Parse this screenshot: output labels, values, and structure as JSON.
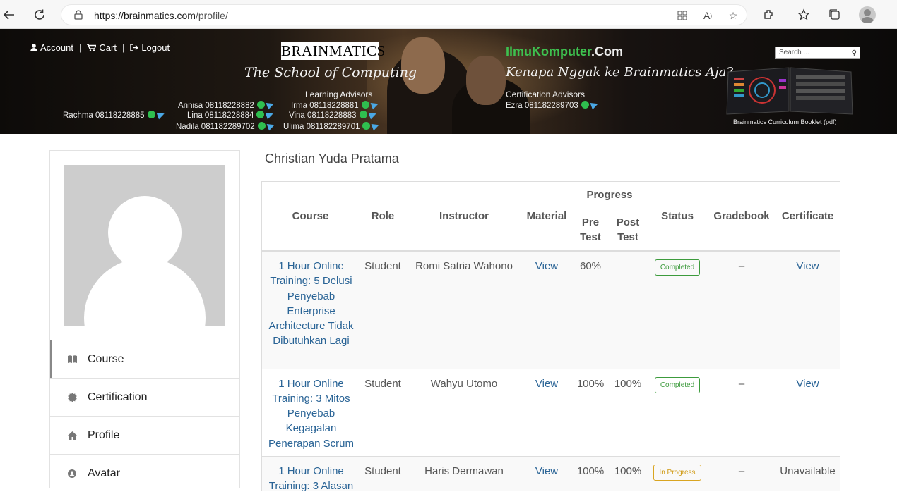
{
  "browser": {
    "url_host": "https://brainmatics.com",
    "url_path": "/profile/"
  },
  "banner": {
    "nav": {
      "account": "Account",
      "cart": "Cart",
      "logout": "Logout"
    },
    "brand": "BRAINMATICS",
    "brand_tagline": "The School of Computing",
    "learning_advisors_title": "Learning Advisors",
    "learning_contacts": [
      "Rachma 08118228885",
      "Annisa 08118228882",
      "Irma 08118228881",
      "Lina 08118228884",
      "Vina 08118228883",
      "Nadila 081182289702",
      "Ulima 081182289701"
    ],
    "ilmu_brand": "IlmuKomputer",
    "ilmu_com": ".Com",
    "ilmu_tagline": "Kenapa Nggak ke Brainmatics Aja?",
    "cert_advisors_title": "Certification Advisors",
    "cert_contact": "Ezra 081182289703",
    "search_placeholder": "Search ...",
    "booklet_caption": "Brainmatics Curriculum Booklet (pdf)"
  },
  "sidebar": {
    "menu": [
      {
        "label": "Course",
        "icon": "book-icon"
      },
      {
        "label": "Certification",
        "icon": "certificate-icon"
      },
      {
        "label": "Profile",
        "icon": "home-icon"
      },
      {
        "label": "Avatar",
        "icon": "user-circle-icon"
      }
    ]
  },
  "main": {
    "user_name": "Christian Yuda Pratama",
    "table": {
      "headers": {
        "course": "Course",
        "role": "Role",
        "instructor": "Instructor",
        "material": "Material",
        "progress": "Progress",
        "pre_test": "Pre Test",
        "post_test": "Post Test",
        "status": "Status",
        "gradebook": "Gradebook",
        "certificate": "Certificate"
      },
      "rows": [
        {
          "course": "1 Hour Online Training: 5 Delusi Penyebab Enterprise Architecture Tidak Dibutuhkan Lagi",
          "role": "Student",
          "instructor": "Romi Satria Wahono",
          "material": "View",
          "pre_test": "60%",
          "post_test": "",
          "status": "Completed",
          "gradebook": "–",
          "certificate": "View"
        },
        {
          "course": "1 Hour Online Training: 3 Mitos Penyebab Kegagalan Penerapan Scrum",
          "role": "Student",
          "instructor": "Wahyu Utomo",
          "material": "View",
          "pre_test": "100%",
          "post_test": "100%",
          "status": "Completed",
          "gradebook": "–",
          "certificate": "View"
        },
        {
          "course": "1 Hour Online Training: 3 Alasan",
          "role": "Student",
          "instructor": "Haris Dermawan",
          "material": "View",
          "pre_test": "100%",
          "post_test": "100%",
          "status": "In Progress",
          "gradebook": "–",
          "certificate": "Unavailable"
        }
      ]
    }
  }
}
